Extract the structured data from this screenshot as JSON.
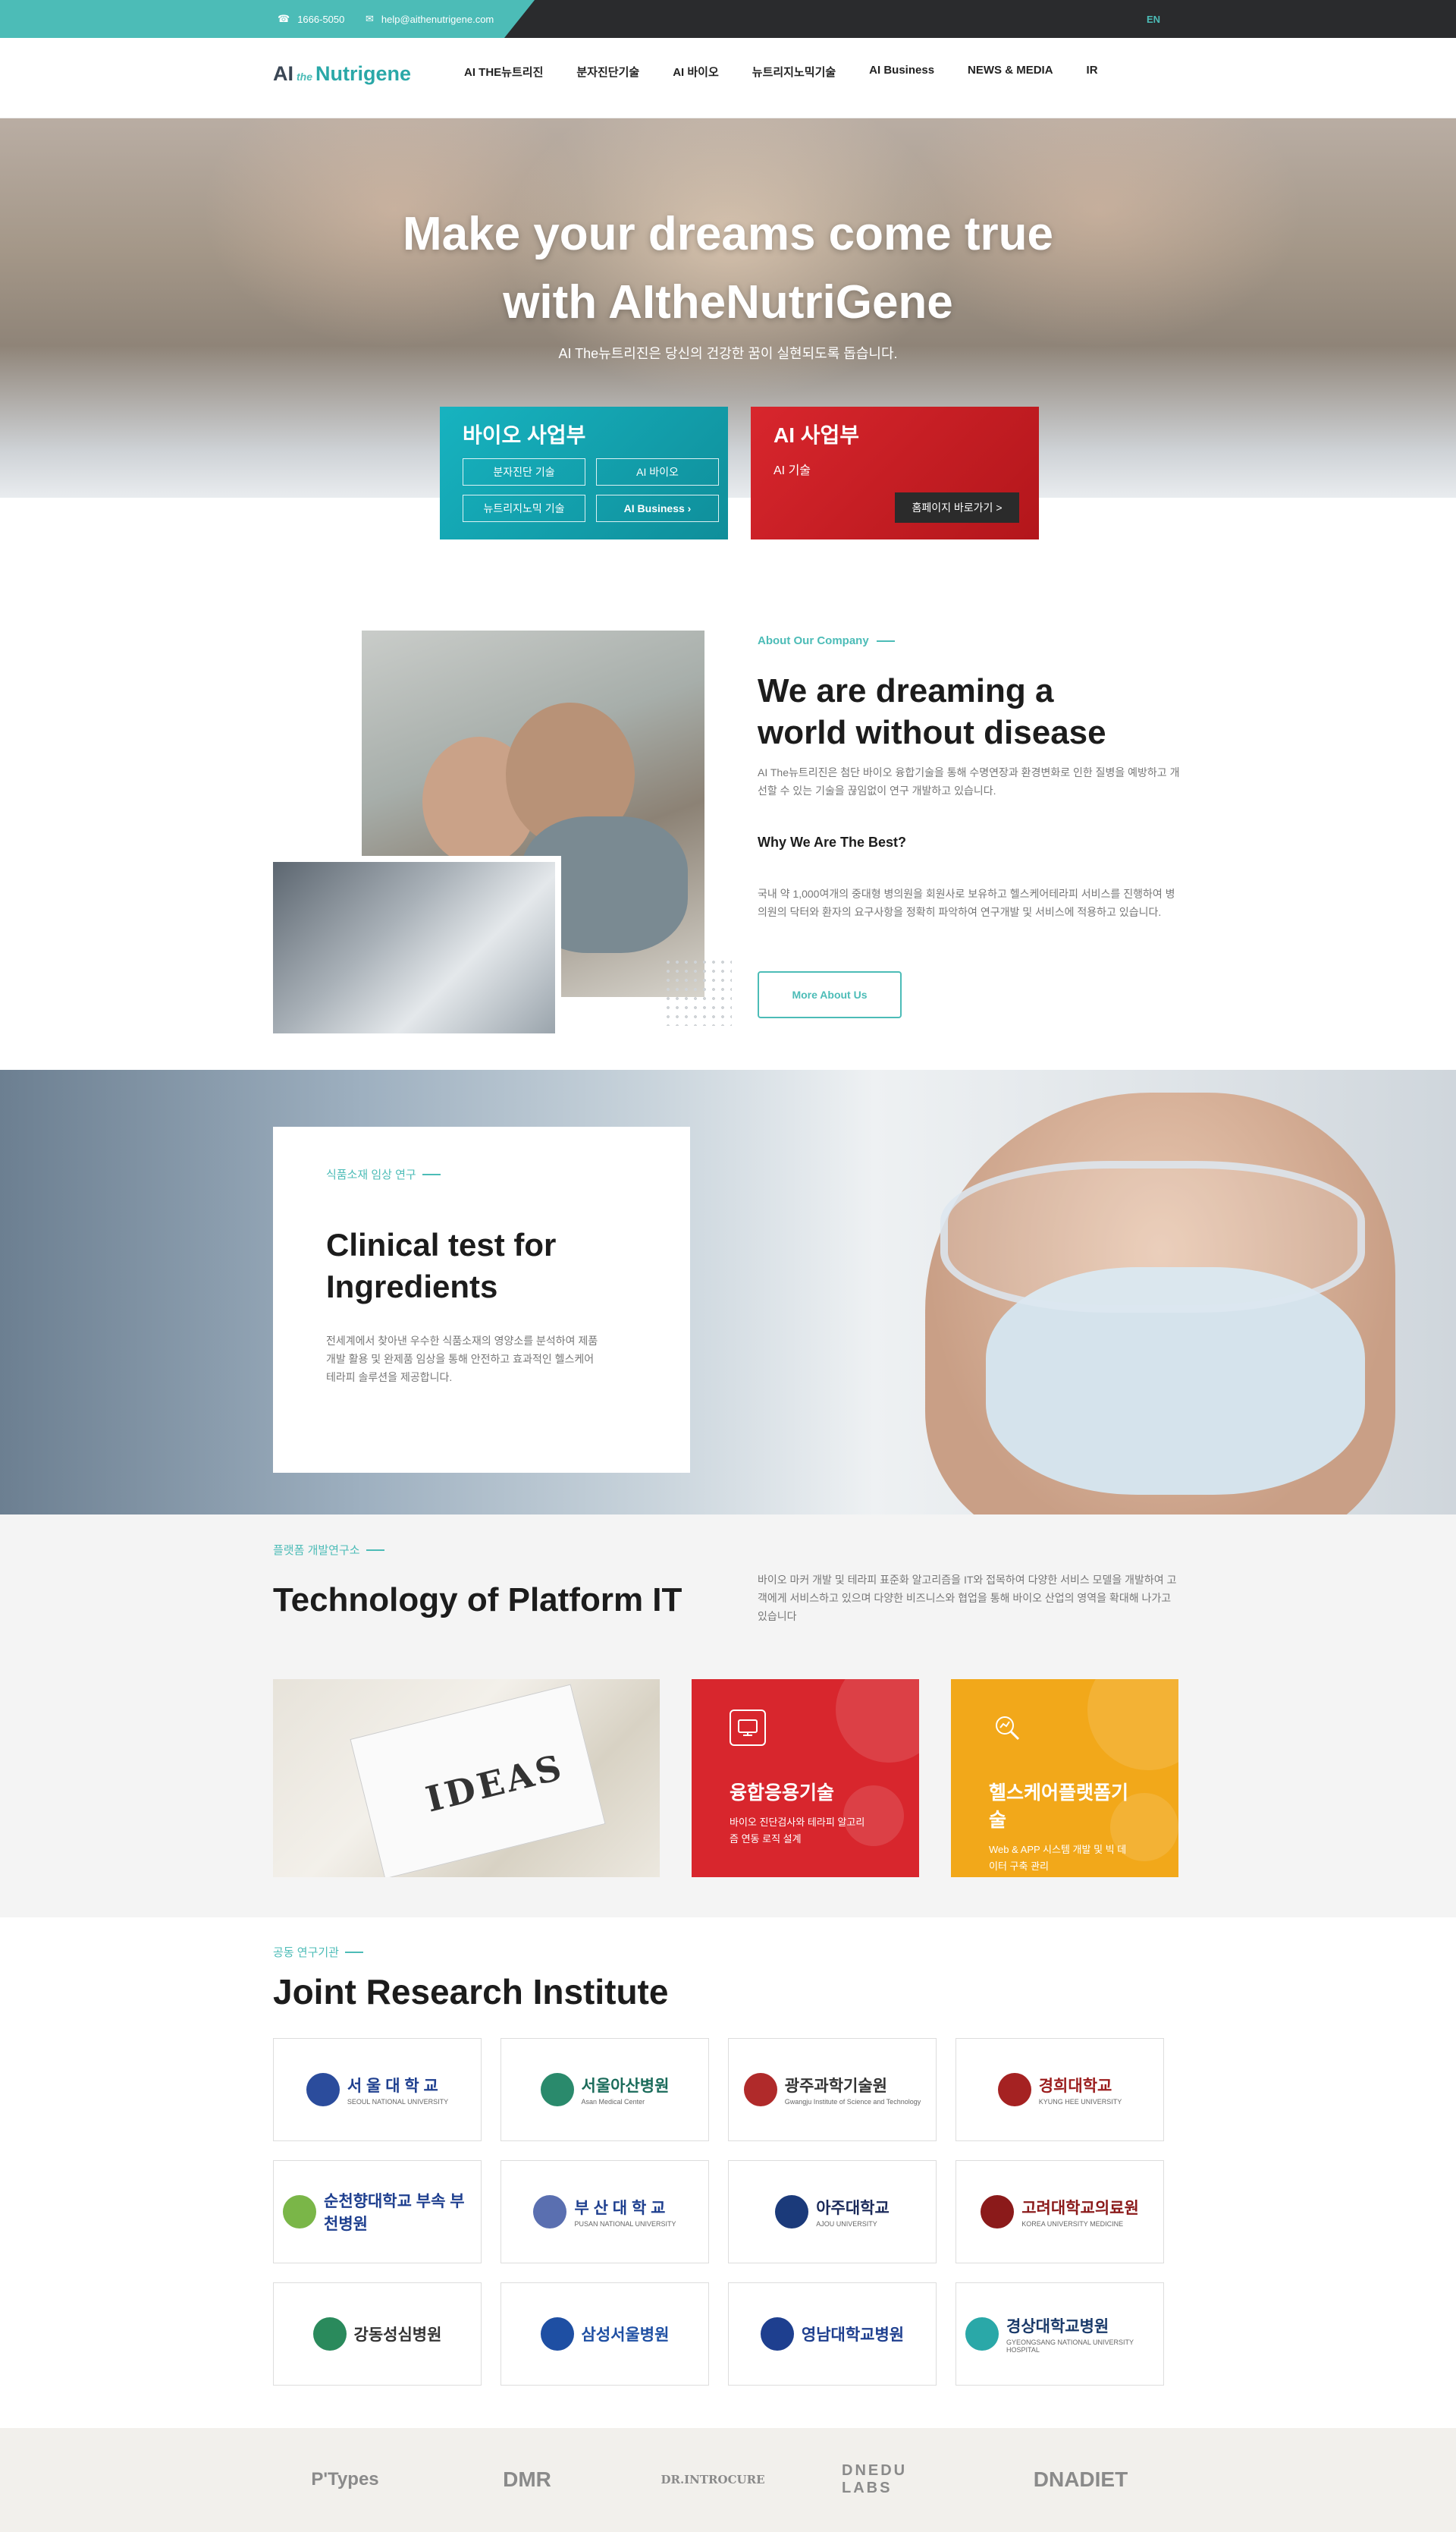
{
  "topbar": {
    "phone": "1666-5050",
    "email": "help@aithenutrigene.com",
    "lang": "EN"
  },
  "header": {
    "logo": {
      "ai": "AI",
      "the": "the",
      "name": "Nutrigene"
    },
    "nav": [
      "AI THE뉴트리진",
      "분자진단기술",
      "AI 바이오",
      "뉴트리지노믹기술",
      "AI Business",
      "NEWS & MEDIA",
      "IR"
    ]
  },
  "hero": {
    "title_line1": "Make your dreams come true",
    "title_line2": "with AItheNutriGene",
    "subtitle": "AI The뉴트리진은 당신의 건강한 꿈이 실현되도록 돕습니다."
  },
  "bio_card": {
    "title": "바이오 사업부",
    "buttons": [
      "분자진단 기술",
      "AI 바이오",
      "뉴트리지노믹 기술",
      "AI Business ›"
    ]
  },
  "ai_card": {
    "title": "AI 사업부",
    "subtitle": "AI 기술",
    "button": "홈페이지 바로가기 >"
  },
  "about": {
    "tag": "About Our Company",
    "title_line1": "We are dreaming a",
    "title_line2": "world without disease",
    "desc": "AI The뉴트리진은 첨단 바이오 융합기술을 통해 수명연장과 환경변화로 인한 질병을 예방하고 개선할 수 있는 기술을 끊임없이 연구 개발하고 있습니다.",
    "why": "Why We Are The Best?",
    "desc2": "국내 약 1,000여개의 중대형 병의원을 회원사로 보유하고 헬스케어테라피 서비스를 진행하여 병의원의 닥터와 환자의 요구사항을 정확히 파악하여 연구개발 및 서비스에 적용하고 있습니다.",
    "button": "More About Us"
  },
  "clinical": {
    "tag": "식품소재 임상 연구",
    "title_line1": "Clinical test for",
    "title_line2": "Ingredients",
    "desc": "전세계에서 찾아낸 우수한 식품소재의 영양소를 분석하여 제품 개발 활용 및 완제품 임상을 통해 안전하고 효과적인 헬스케어 테라피 솔루션을 제공합니다."
  },
  "platform": {
    "tag": "플랫폼 개발연구소",
    "title": "Technology of Platform IT",
    "desc": "바이오 마커 개발 및 테라피 표준화 알고리즘을 IT와 접목하여 다양한 서비스 모델을 개발하여 고객에게 서비스하고 있으며 다양한 비즈니스와 협업을 통해 바이오 산업의 영역을 확대해 나가고 있습니다",
    "image_text": "IDEAS",
    "tiles": [
      {
        "icon": "monitor-icon",
        "title": "융합응용기술",
        "desc": "바이오 진단검사와 테라피 알고리즘 연동 로직 설계",
        "color": "#d8262d"
      },
      {
        "icon": "magnifier-chart-icon",
        "title": "헬스케어플랫폼기술",
        "desc": "Web & APP 시스템 개발 및 빅 데이터 구축 관리",
        "color": "#f2a81a"
      }
    ]
  },
  "joint": {
    "tag": "공동 연구기관",
    "title": "Joint Research Institute",
    "institutes": [
      {
        "name": "서 울 대 학 교",
        "en": "SEOUL NATIONAL UNIVERSITY",
        "color": "#1e3f8f",
        "emblem": "#2b4c9c"
      },
      {
        "name": "서울아산병원",
        "en": "Asan Medical Center",
        "color": "#1a6b5a",
        "emblem": "#2a8a6c"
      },
      {
        "name": "광주과학기술원",
        "en": "Gwangju Institute of Science and Technology",
        "color": "#333333",
        "emblem": "#b02a2a"
      },
      {
        "name": "경희대학교",
        "en": "KYUNG HEE UNIVERSITY",
        "color": "#9b1d1d",
        "emblem": "#a52222"
      },
      {
        "name": "순천향대학교 부속 부천병원",
        "en": "",
        "color": "#1e3f8f",
        "emblem": "#7ab648"
      },
      {
        "name": "부 산 대 학 교",
        "en": "PUSAN NATIONAL UNIVERSITY",
        "color": "#1e3f8f",
        "emblem": "#5a6fb0"
      },
      {
        "name": "아주대학교",
        "en": "AJOU UNIVERSITY",
        "color": "#1b2a5a",
        "emblem": "#1b3a7a"
      },
      {
        "name": "고려대학교의료원",
        "en": "KOREA UNIVERSITY MEDICINE",
        "color": "#8b1a1a",
        "emblem": "#8b1a1a"
      },
      {
        "name": "강동성심병원",
        "en": "",
        "color": "#333333",
        "emblem": "#2a8a5c"
      },
      {
        "name": "삼성서울병원",
        "en": "",
        "color": "#1e4fa3",
        "emblem": "#1e4fa3"
      },
      {
        "name": "영남대학교병원",
        "en": "",
        "color": "#1e3f8f",
        "emblem": "#1e3f8f"
      },
      {
        "name": "경상대학교병원",
        "en": "GYEONGSANG NATIONAL UNIVERSITY HOSPITAL",
        "color": "#1a3a6a",
        "emblem": "#2aa8a8"
      }
    ]
  },
  "partners": [
    "P'Types",
    "DMR",
    "DR.INTROCURE",
    "DNEDU LABS",
    "DNADIET"
  ]
}
